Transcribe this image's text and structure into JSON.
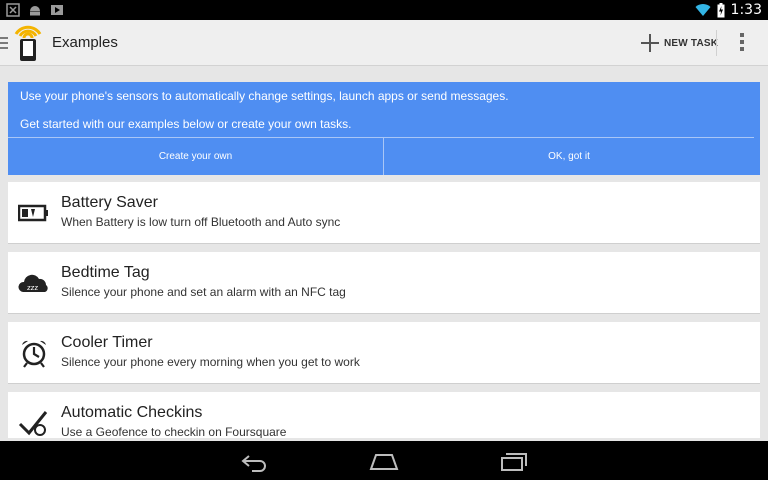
{
  "status_bar": {
    "time": "1:33"
  },
  "action_bar": {
    "title": "Examples",
    "new_task_label": "NEW TASK"
  },
  "banner": {
    "line1": "Use your phone's sensors to automatically change settings, launch apps or send messages.",
    "line2": "Get started with our examples below or create your own tasks.",
    "create_label": "Create your own",
    "ok_label": "OK, got it",
    "color": "#4f8ef2"
  },
  "examples": [
    {
      "title": "Battery Saver",
      "subtitle": "When Battery is low turn off Bluetooth and Auto sync",
      "icon": "battery-low-icon"
    },
    {
      "title": "Bedtime Tag",
      "subtitle": "Silence your phone and set an alarm with an NFC tag",
      "icon": "sleep-cloud-icon"
    },
    {
      "title": "Cooler Timer",
      "subtitle": "Silence your phone every morning when you get to work",
      "icon": "alarm-clock-icon"
    },
    {
      "title": "Automatic Checkins",
      "subtitle": "Use a Geofence to checkin on Foursquare",
      "icon": "checkin-icon"
    }
  ]
}
